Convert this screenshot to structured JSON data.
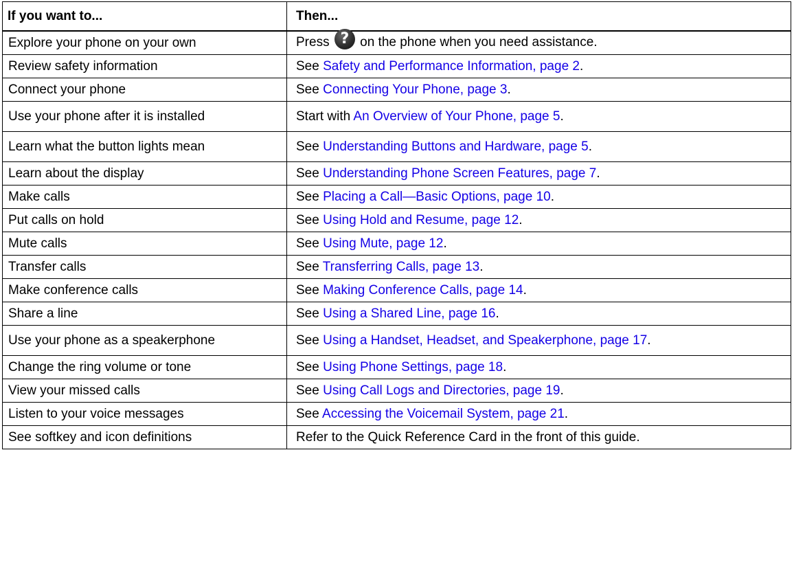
{
  "header": {
    "col1": "If you want to...",
    "col2": "Then..."
  },
  "rows": [
    {
      "want": "Explore your phone on your own",
      "pre": "Press ",
      "icon": "help-question-icon",
      "post": " on the phone when you need assistance."
    },
    {
      "want": "Review safety information",
      "pre": "See ",
      "link": "Safety and Performance Information, page 2",
      "post": "."
    },
    {
      "want": "Connect your phone",
      "pre": "See ",
      "link": "Connecting Your Phone, page 3",
      "post": "."
    },
    {
      "want": "Use your phone after it is installed",
      "pre": "Start with ",
      "link": "An Overview of Your Phone, page 5",
      "post": "."
    },
    {
      "want": "Learn what the button lights mean",
      "pre": "See ",
      "link": "Understanding Buttons and Hardware, page 5",
      "post": "."
    },
    {
      "want": "Learn about the display",
      "pre": "See ",
      "link": "Understanding Phone Screen Features, page 7",
      "post": "."
    },
    {
      "want": "Make calls",
      "pre": "See ",
      "link": "Placing a Call—Basic Options, page 10",
      "post": "."
    },
    {
      "want": "Put calls on hold",
      "pre": "See ",
      "link": "Using Hold and Resume, page 12",
      "post": "."
    },
    {
      "want": "Mute calls",
      "pre": "See ",
      "link": "Using Mute, page 12",
      "post": "."
    },
    {
      "want": "Transfer calls",
      "pre": "See ",
      "link": "Transferring Calls, page 13",
      "post": "."
    },
    {
      "want": "Make conference calls",
      "pre": "See ",
      "link": "Making Conference Calls, page 14",
      "post": "."
    },
    {
      "want": "Share a line",
      "pre": "See ",
      "link": "Using a Shared Line, page 16",
      "post": "."
    },
    {
      "want": "Use your phone as a speakerphone",
      "pre": "See ",
      "link": "Using a Handset, Headset, and Speakerphone, page 17",
      "post": "."
    },
    {
      "want": "Change the ring volume or tone",
      "pre": "See ",
      "link": "Using Phone Settings, page 18",
      "post": "."
    },
    {
      "want": "View your missed calls",
      "pre": "See ",
      "link": "Using Call Logs and Directories, page 19",
      "post": "."
    },
    {
      "want": "Listen to your voice messages",
      "pre": "See ",
      "link": "Accessing the Voicemail System, page 21",
      "post": "."
    },
    {
      "want": "See softkey and icon definitions",
      "pre": "Refer to the Quick Reference Card in the front of this guide.",
      "post": ""
    }
  ],
  "colors": {
    "link": "#1400e6",
    "border": "#000000"
  }
}
